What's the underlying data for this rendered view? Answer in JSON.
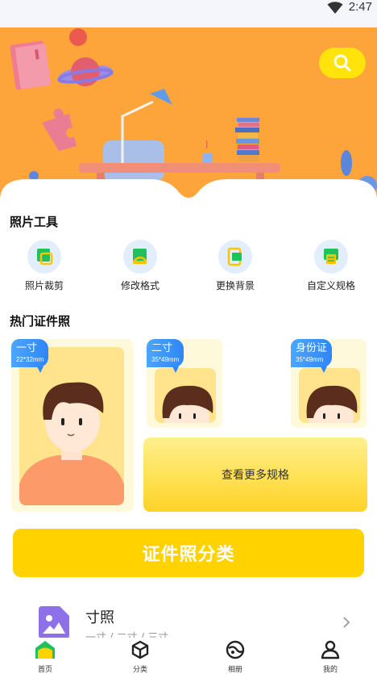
{
  "status_bar": {
    "time": "2:47"
  },
  "banner": {
    "search_icon": "search-icon"
  },
  "photo_tools": {
    "title": "照片工具",
    "items": [
      {
        "label": "照片裁剪",
        "icon": "crop-icon"
      },
      {
        "label": "修改格式",
        "icon": "format-icon"
      },
      {
        "label": "更换背景",
        "icon": "background-swap-icon"
      },
      {
        "label": "自定义规格",
        "icon": "custom-spec-icon"
      }
    ]
  },
  "hot_photos": {
    "title": "热门证件照",
    "cards": [
      {
        "name": "一寸",
        "size": "22*32mm"
      },
      {
        "name": "二寸",
        "size": "35*49mm"
      },
      {
        "name": "身份证",
        "size": "35*49mm"
      }
    ],
    "more_label": "查看更多规格"
  },
  "category_button": {
    "label": "证件照分类"
  },
  "list": [
    {
      "title": "寸照",
      "subtitle": "一寸 / 二寸 / 三寸",
      "icon": "image-icon"
    }
  ],
  "tabbar": {
    "items": [
      {
        "label": "首页",
        "icon": "home-icon",
        "active": true
      },
      {
        "label": "分类",
        "icon": "cube-icon",
        "active": false
      },
      {
        "label": "相册",
        "icon": "album-icon",
        "active": false
      },
      {
        "label": "我的",
        "icon": "user-icon",
        "active": false
      }
    ]
  },
  "colors": {
    "banner": "#fda53b",
    "accent_yellow": "#ffd200",
    "tag_blue": "#2f86f6",
    "tool_green": "#20c05c"
  }
}
